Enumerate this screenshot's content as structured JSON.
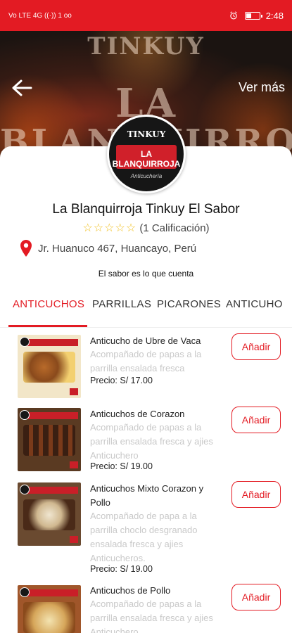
{
  "status_bar": {
    "left_indicators": "Vo LTE  4G  ((·))  1  oo",
    "time": "2:48",
    "battery_level": 0.35
  },
  "hero": {
    "banner_text_top": "TINKUY",
    "banner_text_mid": "LA",
    "banner_text_bottom": "BLANQUIRROJA",
    "more_label": "Ver más"
  },
  "logo": {
    "line1": "TINKUY",
    "line2": "LA BLANQUIRROJA",
    "line3": "Anticuchería"
  },
  "restaurant": {
    "name": "La Blanquirroja Tinkuy El Sabor",
    "stars": "☆☆☆☆☆",
    "rating_count": "(1 Calificación)",
    "address": "Jr. Huanuco 467, Huancayo, Perú",
    "slogan": "El sabor es lo que cuenta"
  },
  "tabs": [
    {
      "label": "ANTICUCHOS"
    },
    {
      "label": "PARRILLAS"
    },
    {
      "label": "PICARONES"
    },
    {
      "label": "ANTICUHO"
    }
  ],
  "products": [
    {
      "name": "Anticucho de Ubre de Vaca",
      "description": "Acompañado de papas a la parrilla ensalada fresca",
      "price": "Precio: S/ 17.00",
      "button": "Añadir"
    },
    {
      "name": "Anticuchos de Corazon",
      "description": "Acompañado de papas a la parrilla ensalada fresca y ajies Anticuchero",
      "price": "Precio: S/ 19.00",
      "button": "Añadir"
    },
    {
      "name": "Anticuchos Mixto Corazon y Pollo",
      "description": "Acompañado de papa a la parrilla choclo desgranado ensalada fresca y ajies Anticucheros.",
      "price": "Precio: S/ 19.00",
      "button": "Añadir"
    },
    {
      "name": "Anticuchos de Pollo",
      "description": "Acompañado de papas a la parrilla ensalada fresca y ajies Anticuchero",
      "price": "",
      "button": "Añadir"
    }
  ],
  "colors": {
    "accent": "#e31b23",
    "star": "#f0c020",
    "muted_text": "#c9c9c9"
  }
}
